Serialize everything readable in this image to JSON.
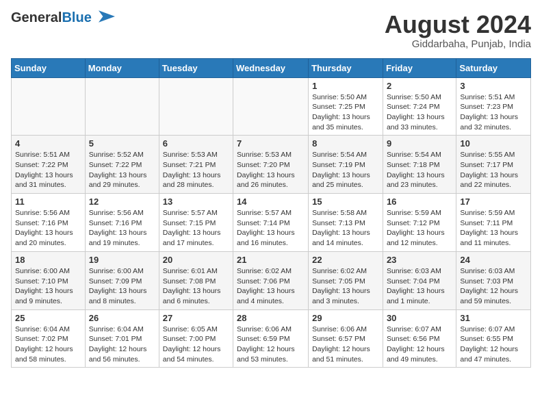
{
  "header": {
    "logo_general": "General",
    "logo_blue": "Blue",
    "month_title": "August 2024",
    "location": "Giddarbaha, Punjab, India"
  },
  "days_of_week": [
    "Sunday",
    "Monday",
    "Tuesday",
    "Wednesday",
    "Thursday",
    "Friday",
    "Saturday"
  ],
  "weeks": [
    [
      {
        "day": "",
        "info": ""
      },
      {
        "day": "",
        "info": ""
      },
      {
        "day": "",
        "info": ""
      },
      {
        "day": "",
        "info": ""
      },
      {
        "day": "1",
        "info": "Sunrise: 5:50 AM\nSunset: 7:25 PM\nDaylight: 13 hours\nand 35 minutes."
      },
      {
        "day": "2",
        "info": "Sunrise: 5:50 AM\nSunset: 7:24 PM\nDaylight: 13 hours\nand 33 minutes."
      },
      {
        "day": "3",
        "info": "Sunrise: 5:51 AM\nSunset: 7:23 PM\nDaylight: 13 hours\nand 32 minutes."
      }
    ],
    [
      {
        "day": "4",
        "info": "Sunrise: 5:51 AM\nSunset: 7:22 PM\nDaylight: 13 hours\nand 31 minutes."
      },
      {
        "day": "5",
        "info": "Sunrise: 5:52 AM\nSunset: 7:22 PM\nDaylight: 13 hours\nand 29 minutes."
      },
      {
        "day": "6",
        "info": "Sunrise: 5:53 AM\nSunset: 7:21 PM\nDaylight: 13 hours\nand 28 minutes."
      },
      {
        "day": "7",
        "info": "Sunrise: 5:53 AM\nSunset: 7:20 PM\nDaylight: 13 hours\nand 26 minutes."
      },
      {
        "day": "8",
        "info": "Sunrise: 5:54 AM\nSunset: 7:19 PM\nDaylight: 13 hours\nand 25 minutes."
      },
      {
        "day": "9",
        "info": "Sunrise: 5:54 AM\nSunset: 7:18 PM\nDaylight: 13 hours\nand 23 minutes."
      },
      {
        "day": "10",
        "info": "Sunrise: 5:55 AM\nSunset: 7:17 PM\nDaylight: 13 hours\nand 22 minutes."
      }
    ],
    [
      {
        "day": "11",
        "info": "Sunrise: 5:56 AM\nSunset: 7:16 PM\nDaylight: 13 hours\nand 20 minutes."
      },
      {
        "day": "12",
        "info": "Sunrise: 5:56 AM\nSunset: 7:16 PM\nDaylight: 13 hours\nand 19 minutes."
      },
      {
        "day": "13",
        "info": "Sunrise: 5:57 AM\nSunset: 7:15 PM\nDaylight: 13 hours\nand 17 minutes."
      },
      {
        "day": "14",
        "info": "Sunrise: 5:57 AM\nSunset: 7:14 PM\nDaylight: 13 hours\nand 16 minutes."
      },
      {
        "day": "15",
        "info": "Sunrise: 5:58 AM\nSunset: 7:13 PM\nDaylight: 13 hours\nand 14 minutes."
      },
      {
        "day": "16",
        "info": "Sunrise: 5:59 AM\nSunset: 7:12 PM\nDaylight: 13 hours\nand 12 minutes."
      },
      {
        "day": "17",
        "info": "Sunrise: 5:59 AM\nSunset: 7:11 PM\nDaylight: 13 hours\nand 11 minutes."
      }
    ],
    [
      {
        "day": "18",
        "info": "Sunrise: 6:00 AM\nSunset: 7:10 PM\nDaylight: 13 hours\nand 9 minutes."
      },
      {
        "day": "19",
        "info": "Sunrise: 6:00 AM\nSunset: 7:09 PM\nDaylight: 13 hours\nand 8 minutes."
      },
      {
        "day": "20",
        "info": "Sunrise: 6:01 AM\nSunset: 7:08 PM\nDaylight: 13 hours\nand 6 minutes."
      },
      {
        "day": "21",
        "info": "Sunrise: 6:02 AM\nSunset: 7:06 PM\nDaylight: 13 hours\nand 4 minutes."
      },
      {
        "day": "22",
        "info": "Sunrise: 6:02 AM\nSunset: 7:05 PM\nDaylight: 13 hours\nand 3 minutes."
      },
      {
        "day": "23",
        "info": "Sunrise: 6:03 AM\nSunset: 7:04 PM\nDaylight: 13 hours\nand 1 minute."
      },
      {
        "day": "24",
        "info": "Sunrise: 6:03 AM\nSunset: 7:03 PM\nDaylight: 12 hours\nand 59 minutes."
      }
    ],
    [
      {
        "day": "25",
        "info": "Sunrise: 6:04 AM\nSunset: 7:02 PM\nDaylight: 12 hours\nand 58 minutes."
      },
      {
        "day": "26",
        "info": "Sunrise: 6:04 AM\nSunset: 7:01 PM\nDaylight: 12 hours\nand 56 minutes."
      },
      {
        "day": "27",
        "info": "Sunrise: 6:05 AM\nSunset: 7:00 PM\nDaylight: 12 hours\nand 54 minutes."
      },
      {
        "day": "28",
        "info": "Sunrise: 6:06 AM\nSunset: 6:59 PM\nDaylight: 12 hours\nand 53 minutes."
      },
      {
        "day": "29",
        "info": "Sunrise: 6:06 AM\nSunset: 6:57 PM\nDaylight: 12 hours\nand 51 minutes."
      },
      {
        "day": "30",
        "info": "Sunrise: 6:07 AM\nSunset: 6:56 PM\nDaylight: 12 hours\nand 49 minutes."
      },
      {
        "day": "31",
        "info": "Sunrise: 6:07 AM\nSunset: 6:55 PM\nDaylight: 12 hours\nand 47 minutes."
      }
    ]
  ]
}
